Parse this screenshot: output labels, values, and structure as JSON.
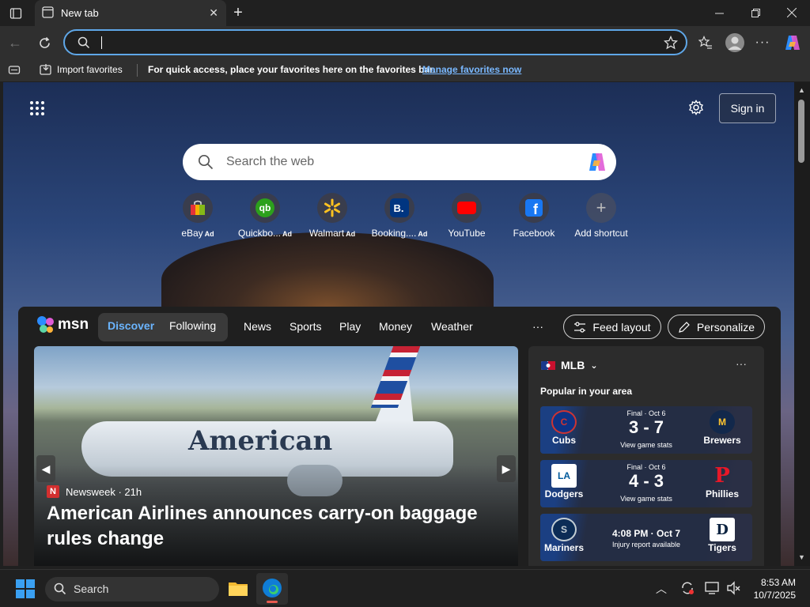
{
  "browser": {
    "tab_title": "New tab",
    "address_value": "",
    "favorites_bar": {
      "import_label": "Import favorites",
      "hint": "For quick access, place your favorites here on the favorites bar.",
      "manage_link": "Manage favorites now"
    }
  },
  "newtab": {
    "search_placeholder": "Search the web",
    "sign_in": "Sign in",
    "shortcuts": [
      {
        "label": "eBay",
        "ad": "Ad",
        "icon": "ebay-icon"
      },
      {
        "label": "Quickbo...",
        "ad": "Ad",
        "icon": "quickbooks-icon"
      },
      {
        "label": "Walmart",
        "ad": "Ad",
        "icon": "walmart-icon"
      },
      {
        "label": "Booking....",
        "ad": "Ad",
        "icon": "booking-icon"
      },
      {
        "label": "YouTube",
        "ad": "",
        "icon": "youtube-icon"
      },
      {
        "label": "Facebook",
        "ad": "",
        "icon": "facebook-icon"
      },
      {
        "label": "Add shortcut",
        "ad": "",
        "icon": "plus-icon"
      }
    ]
  },
  "feed": {
    "brand": "msn",
    "tabs": {
      "discover": "Discover",
      "following": "Following"
    },
    "nav": [
      "News",
      "Sports",
      "Play",
      "Money",
      "Weather"
    ],
    "more": "···",
    "feed_layout": "Feed layout",
    "personalize": "Personalize",
    "hero": {
      "source": "Newsweek · 21h",
      "source_badge": "N",
      "brand_on_plane": "American",
      "headline": "American Airlines announces carry-on baggage rules change"
    },
    "mlb": {
      "title": "MLB",
      "subtitle": "Popular in your area",
      "games": [
        {
          "status": "Final · Oct 6",
          "score": "3 - 7",
          "sub": "View game stats",
          "home": "Cubs",
          "away": "Brewers",
          "home_logo": "C",
          "away_logo": "M"
        },
        {
          "status": "Final · Oct 6",
          "score": "4 - 3",
          "sub": "View game stats",
          "home": "Dodgers",
          "away": "Phillies",
          "home_logo": "LA",
          "away_logo": "P"
        },
        {
          "status": "",
          "score": "4:08 PM · Oct 7",
          "sub": "Injury report available",
          "home": "Mariners",
          "away": "Tigers",
          "home_logo": "S",
          "away_logo": "D"
        }
      ]
    }
  },
  "taskbar": {
    "search_label": "Search",
    "time": "8:53 AM",
    "date": "10/7/2025"
  },
  "colors": {
    "accent": "#5fa7e8",
    "link": "#79b8ff",
    "discover": "#6bb5ff"
  }
}
